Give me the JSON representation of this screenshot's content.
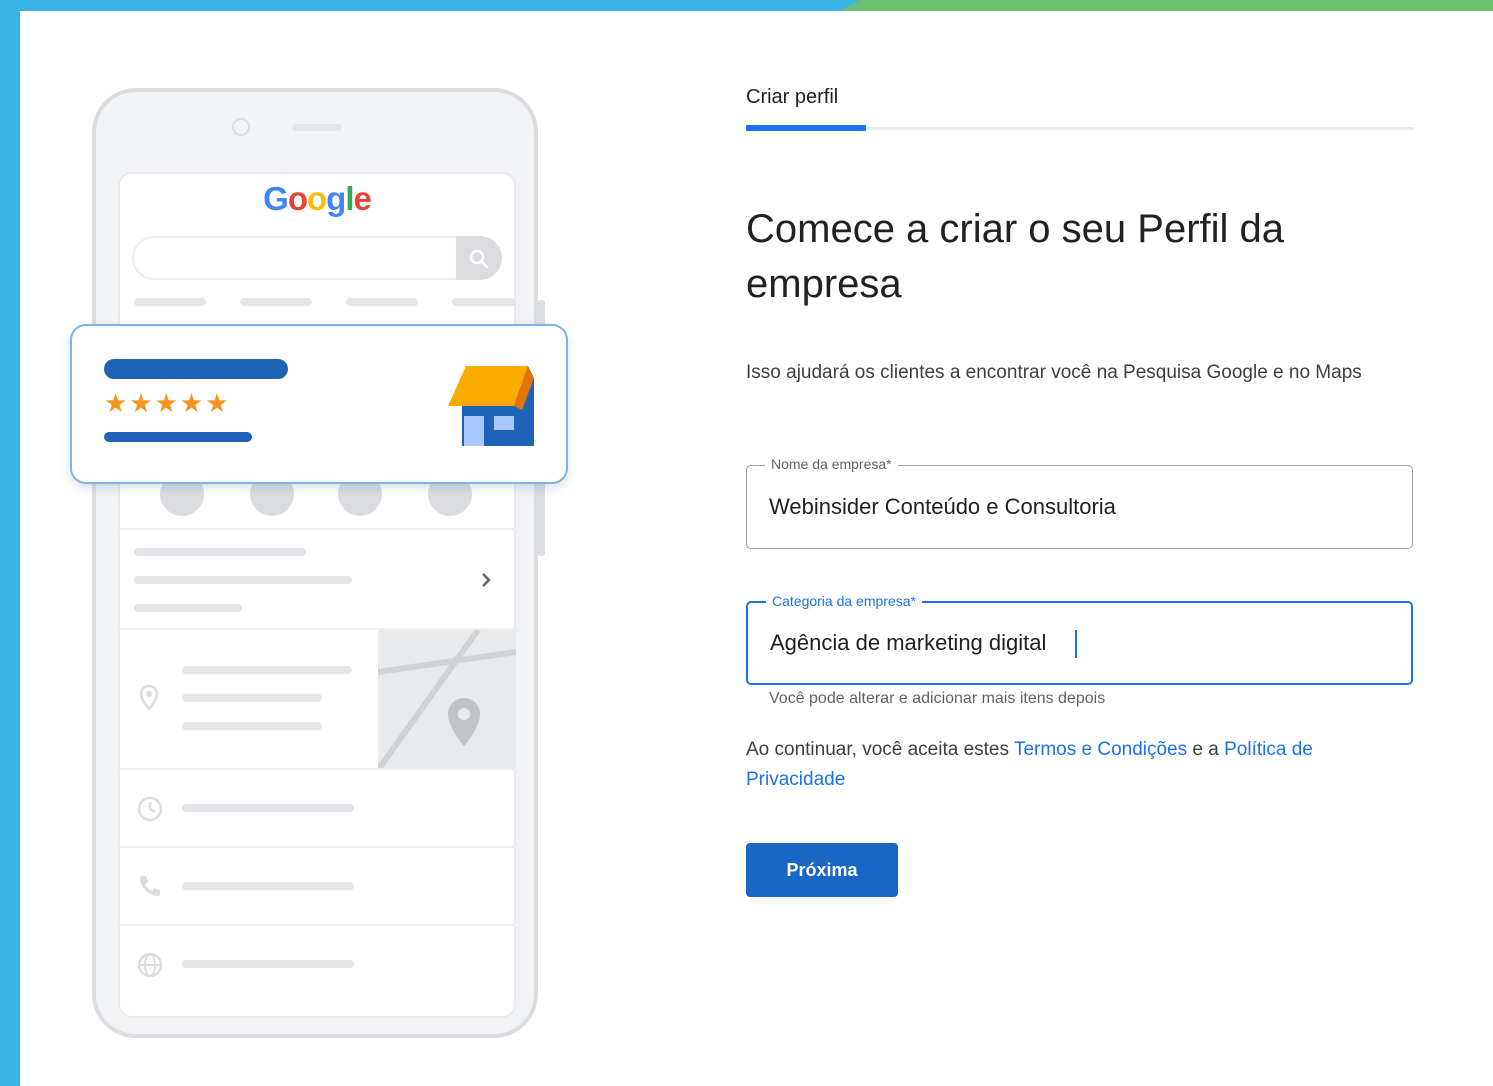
{
  "colors": {
    "frame_blue": "#3bb3e4",
    "frame_green": "#6cbf6e",
    "accent": "#1a73e8",
    "button": "#1a66c5",
    "star": "#f7931e"
  },
  "illustration": {
    "logo": {
      "letters": [
        {
          "ch": "G",
          "color": "blue"
        },
        {
          "ch": "o",
          "color": "red"
        },
        {
          "ch": "o",
          "color": "yellow"
        },
        {
          "ch": "g",
          "color": "blue"
        },
        {
          "ch": "l",
          "color": "green"
        },
        {
          "ch": "e",
          "color": "red"
        }
      ]
    },
    "rating_stars": "★★★★★",
    "icons": [
      "search-icon",
      "store-icon",
      "location-pin-icon",
      "clock-icon",
      "phone-icon",
      "globe-icon",
      "chevron-right-icon"
    ]
  },
  "tabs": {
    "current": "Criar perfil",
    "progress": 0.18
  },
  "form": {
    "heading": "Comece a criar o seu Perfil da empresa",
    "subtitle": "Isso ajudará os clientes a encontrar você na Pesquisa Google e no Maps",
    "business_name": {
      "label": "Nome da empresa*",
      "value": "Webinsider Conteúdo e Consultoria"
    },
    "business_category": {
      "label": "Categoria da empresa*",
      "value": "Agência de marketing digital",
      "helper": "Você pode alterar e adicionar mais itens depois"
    },
    "consent": {
      "prefix": "Ao continuar, você aceita estes ",
      "terms_link": "Termos e Condições",
      "middle": " e a ",
      "privacy_link": "Política de Privacidade"
    },
    "next_button": "Próxima"
  }
}
